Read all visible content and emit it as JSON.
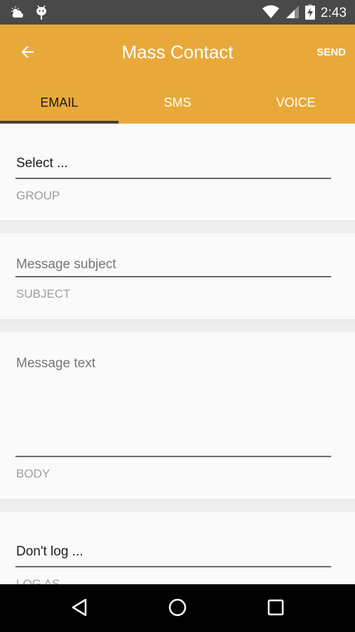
{
  "status_bar": {
    "icons_left": [
      "weather-partly-cloudy-icon",
      "android-debug-icon"
    ],
    "icons_right": [
      "wifi-icon",
      "cellular-signal-icon",
      "battery-charging-icon"
    ],
    "time": "2:43"
  },
  "app_bar": {
    "back_icon": "arrow-back-icon",
    "title": "Mass Contact",
    "action_label": "SEND",
    "background_color": "#e9a93a"
  },
  "tabs": [
    {
      "label": "EMAIL",
      "active": true
    },
    {
      "label": "SMS",
      "active": false
    },
    {
      "label": "VOICE",
      "active": false
    }
  ],
  "form": {
    "group": {
      "value": "Select ...",
      "label": "GROUP"
    },
    "subject": {
      "placeholder": "Message subject",
      "value": "",
      "label": "SUBJECT"
    },
    "body": {
      "placeholder": "Message text",
      "value": "",
      "label": "BODY"
    },
    "log_as": {
      "value": "Don't log ...",
      "label": "LOG AS"
    }
  },
  "nav_bar": {
    "buttons": [
      "back-triangle-icon",
      "home-circle-icon",
      "recents-square-icon"
    ]
  }
}
